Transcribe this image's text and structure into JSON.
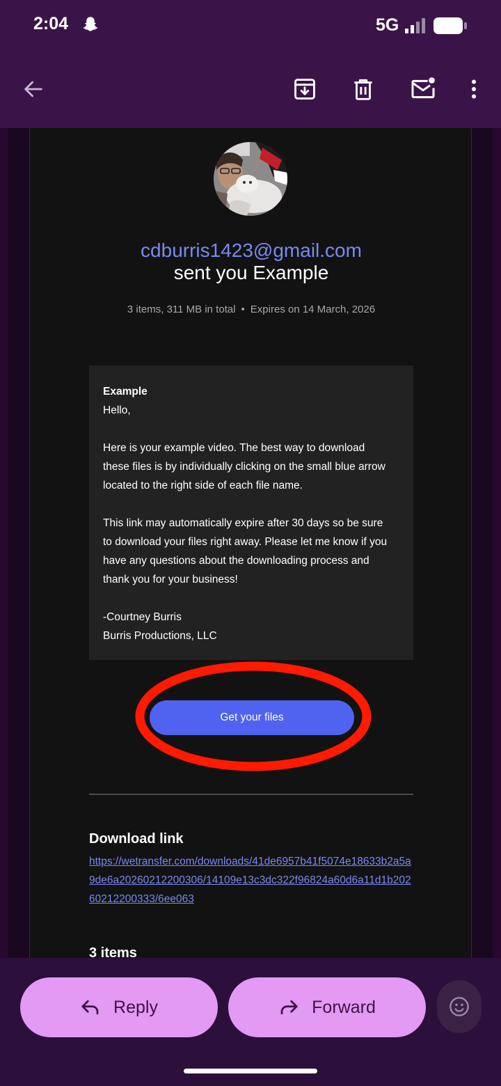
{
  "status_bar": {
    "time": "2:04",
    "network": "5G",
    "icons": [
      "snapchat-icon",
      "signal-icon",
      "battery-icon"
    ]
  },
  "app_bar": {
    "actions": [
      "back-arrow-icon",
      "archive-icon",
      "delete-icon",
      "mark-unread-icon",
      "more-vert-icon"
    ]
  },
  "email": {
    "sender": "cdburris1423@gmail.com",
    "sent_line": "sent you Example",
    "summary": "3 items, 311 MB in total",
    "separator": "•",
    "expires": "Expires on 14 March, 2026",
    "message": {
      "title": "Example",
      "greeting": "Hello,",
      "paragraph1": "Here is your example video. The best way to download\nthese files is by individually clicking on the small blue arrow\nlocated to the right side of each file name.",
      "paragraph2": "This link may automatically expire after 30 days so be sure\nto download your files right away. Please let me know if you\nhave any questions about the downloading process and\nthank you for your business!",
      "signature_name": "-Courtney Burris",
      "signature_company": "Burris Productions, LLC"
    },
    "cta_label": "Get your files",
    "download_heading": "Download link",
    "download_url": "https://wetransfer.com/downloads/41de6957b41f5074e18633b2a5a9de6a20260212200306/14109e13c3dc322f96824a60d6a11d1b20260212200333/6ee063",
    "items_heading": "3 items"
  },
  "bottom_actions": {
    "reply_label": "Reply",
    "forward_label": "Forward"
  },
  "colors": {
    "app_bar": "#3a1449",
    "link": "#7b88f0",
    "cta": "#4f62f0",
    "pill": "#e39af3",
    "highlight": "#ff1a00"
  }
}
